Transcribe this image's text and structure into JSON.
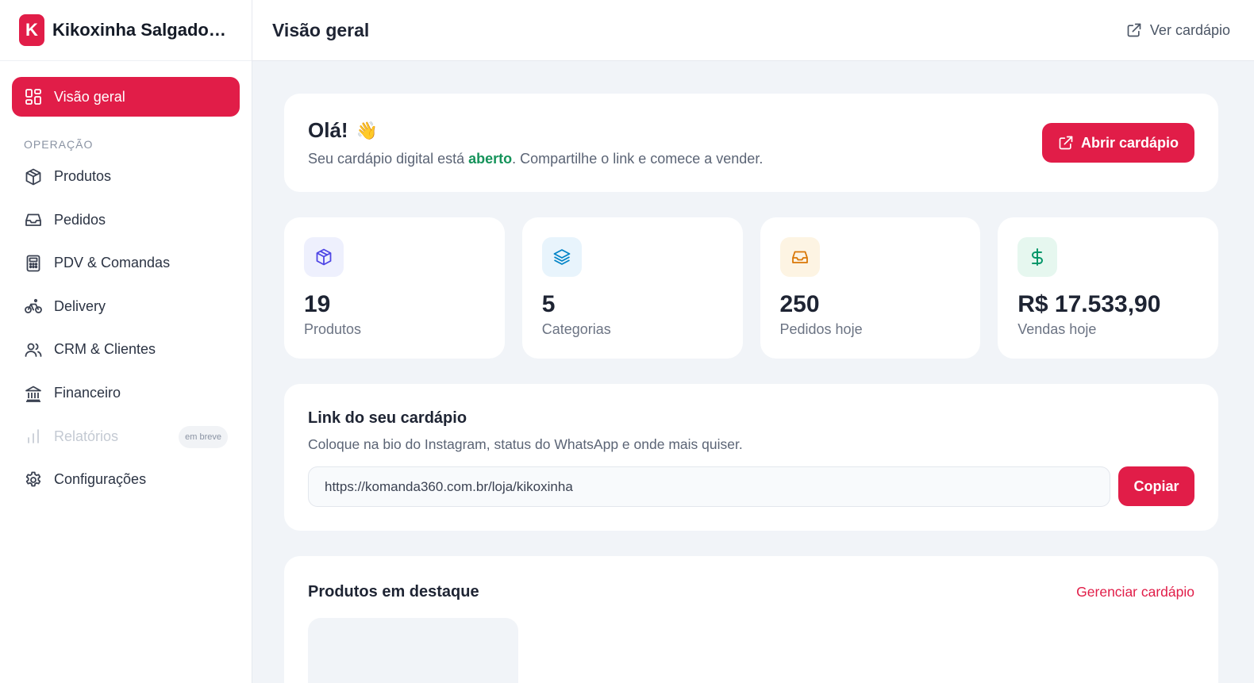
{
  "brand": {
    "logo_letter": "K",
    "name": "Kikoxinha Salgados e Lanches"
  },
  "header": {
    "title": "Visão geral",
    "view_menu_label": "Ver cardápio"
  },
  "sidebar": {
    "overview_label": "Visão geral",
    "section_label": "OPERAÇÃO",
    "items": [
      {
        "label": "Produtos",
        "icon": "box-icon"
      },
      {
        "label": "Pedidos",
        "icon": "inbox-icon"
      },
      {
        "label": "PDV & Comandas",
        "icon": "calculator-icon"
      },
      {
        "label": "Delivery",
        "icon": "bicycle-icon"
      },
      {
        "label": "CRM & Clientes",
        "icon": "users-icon"
      },
      {
        "label": "Financeiro",
        "icon": "bank-icon"
      },
      {
        "label": "Relatórios",
        "icon": "bar-chart-icon",
        "badge": "em breve",
        "disabled": true
      },
      {
        "label": "Configurações",
        "icon": "gear-icon"
      }
    ]
  },
  "welcome": {
    "greeting": "Olá!",
    "wave": "👋",
    "text_before": "Seu cardápio digital está ",
    "status": "aberto",
    "text_after": ". Compartilhe o link e comece a vender.",
    "button_label": "Abrir cardápio"
  },
  "stats": [
    {
      "value": "19",
      "label": "Produtos",
      "icon": "box-icon",
      "color": "#4f46e5",
      "bg": "#eef0fd"
    },
    {
      "value": "5",
      "label": "Categorias",
      "icon": "layers-icon",
      "color": "#0284c7",
      "bg": "#e8f4fc"
    },
    {
      "value": "250",
      "label": "Pedidos hoje",
      "icon": "inbox-icon",
      "color": "#d97706",
      "bg": "#fdf4e3"
    },
    {
      "value": "R$ 17.533,90",
      "label": "Vendas hoje",
      "icon": "dollar-icon",
      "color": "#059669",
      "bg": "#e6f7ef"
    }
  ],
  "link_card": {
    "title": "Link do seu cardápio",
    "subtitle": "Coloque na bio do Instagram, status do WhatsApp e onde mais quiser.",
    "url": "https://komanda360.com.br/loja/kikoxinha",
    "copy_label": "Copiar"
  },
  "featured": {
    "title": "Produtos em destaque",
    "manage_label": "Gerenciar cardápio"
  },
  "colors": {
    "accent": "#e11d48",
    "status_open": "#15935a"
  }
}
